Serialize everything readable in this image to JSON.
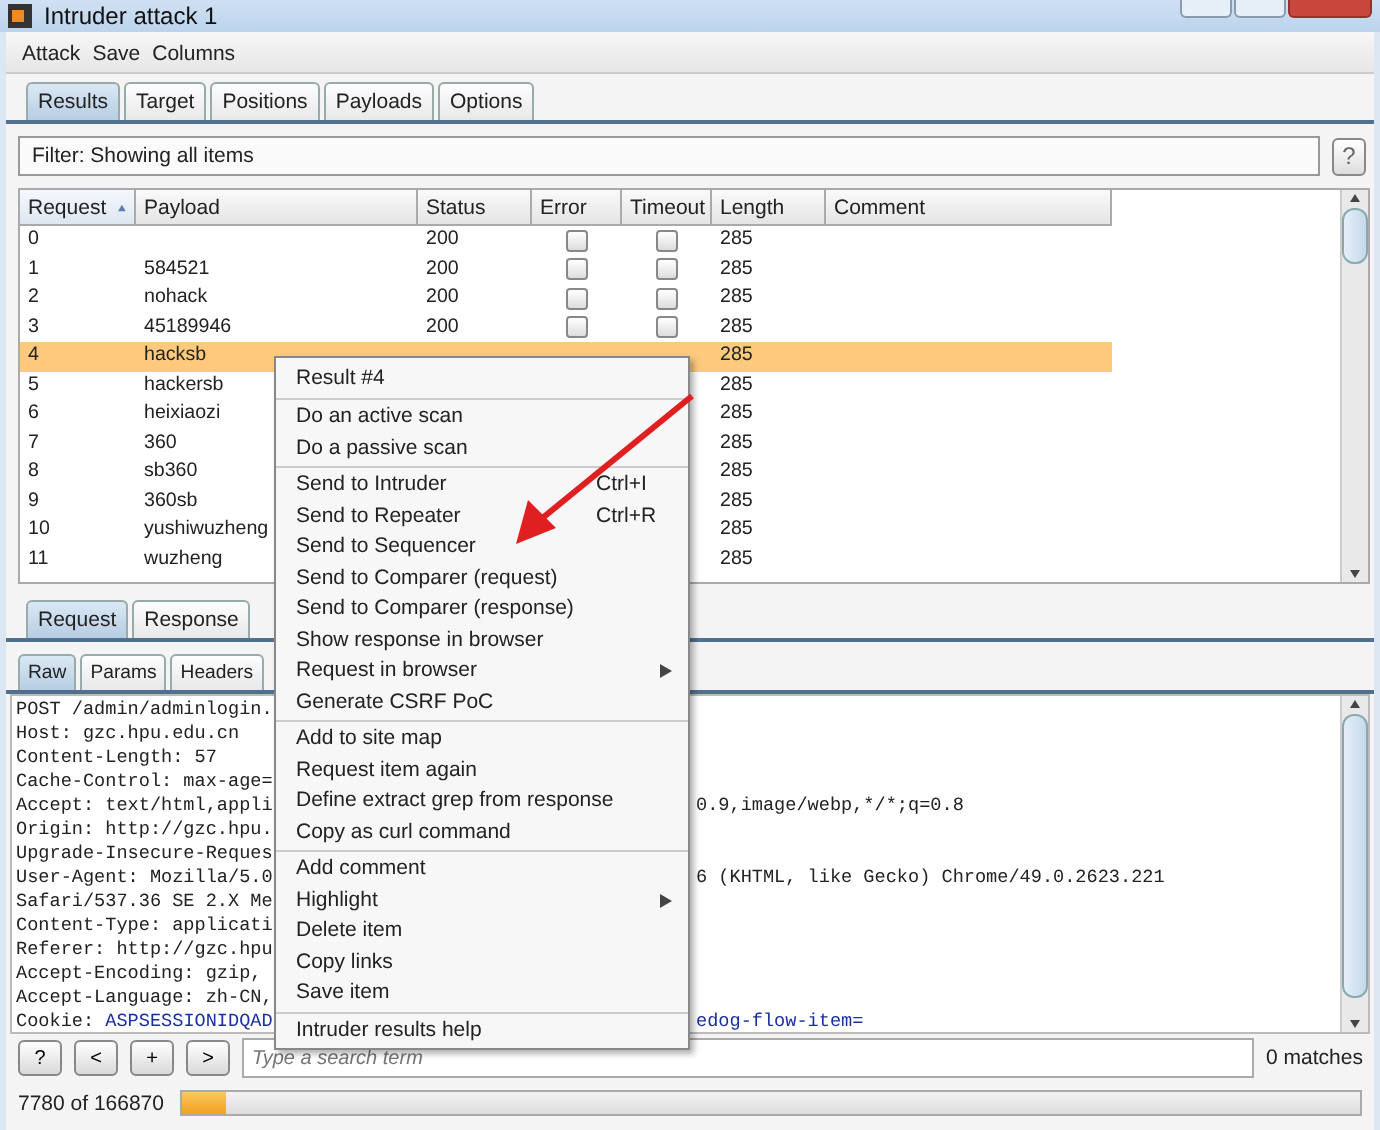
{
  "window": {
    "title": "Intruder attack 1"
  },
  "menu_bar": [
    "Attack",
    "Save",
    "Columns"
  ],
  "tabs": [
    {
      "label": "Results",
      "selected": true
    },
    {
      "label": "Target",
      "selected": false
    },
    {
      "label": "Positions",
      "selected": false
    },
    {
      "label": "Payloads",
      "selected": false
    },
    {
      "label": "Options",
      "selected": false
    }
  ],
  "filter": {
    "text": "Filter: Showing all items",
    "help": "?"
  },
  "table": {
    "columns": [
      {
        "label": "Request",
        "sorted": true
      },
      {
        "label": "Payload",
        "sorted": false
      },
      {
        "label": "Status",
        "sorted": false
      },
      {
        "label": "Error",
        "sorted": false
      },
      {
        "label": "Timeout",
        "sorted": false
      },
      {
        "label": "Length",
        "sorted": false
      },
      {
        "label": "Comment",
        "sorted": false
      }
    ],
    "rows": [
      {
        "request": "0",
        "status": "200",
        "error": false,
        "timeout": false,
        "length": "285",
        "selected": false
      },
      {
        "request": "1",
        "payload": "584521",
        "status": "200",
        "error": false,
        "timeout": false,
        "length": "285",
        "selected": false
      },
      {
        "request": "2",
        "payload": "nohack",
        "status": "200",
        "error": false,
        "timeout": false,
        "length": "285",
        "selected": false
      },
      {
        "request": "3",
        "payload": "45189946",
        "status": "200",
        "error": false,
        "timeout": false,
        "length": "285",
        "selected": false
      },
      {
        "request": "4",
        "payload": "hacksb",
        "length": "285",
        "selected": true
      },
      {
        "request": "5",
        "payload": "hackersb",
        "length": "285",
        "selected": false
      },
      {
        "request": "6",
        "payload": "heixiaozi",
        "length": "285",
        "selected": false
      },
      {
        "request": "7",
        "payload": "360",
        "length": "285",
        "selected": false
      },
      {
        "request": "8",
        "payload": "sb360",
        "length": "285",
        "selected": false
      },
      {
        "request": "9",
        "payload": "360sb",
        "length": "285",
        "selected": false
      },
      {
        "request": "10",
        "payload": "yushiwuzheng",
        "length": "285",
        "selected": false
      },
      {
        "request": "11",
        "payload": "wuzheng",
        "length": "285",
        "selected": false
      }
    ]
  },
  "message_tabs": [
    {
      "label": "Request",
      "selected": true
    },
    {
      "label": "Response",
      "selected": false
    }
  ],
  "view_tabs": [
    {
      "label": "Raw",
      "selected": true
    },
    {
      "label": "Params",
      "selected": false
    },
    {
      "label": "Headers",
      "selected": false
    }
  ],
  "raw_lines": [
    {
      "left": [
        {
          "text": "POST /admin/adminlogin.",
          "kind": "plain"
        }
      ]
    },
    {
      "left": [
        {
          "text": "Host: gzc.hpu.edu.cn",
          "kind": "plain"
        }
      ]
    },
    {
      "left": [
        {
          "text": "Content-Length: 57",
          "kind": "plain"
        }
      ]
    },
    {
      "left": [
        {
          "text": "Cache-Control: max-age=",
          "kind": "plain"
        }
      ]
    },
    {
      "left": [
        {
          "text": "Accept: text/html,appli",
          "kind": "plain"
        }
      ],
      "right": [
        {
          "text": "0.9,image/webp,*/*;q=0.8",
          "kind": "plain"
        }
      ]
    },
    {
      "left": [
        {
          "text": "Origin: http://gzc.hpu.",
          "kind": "plain"
        }
      ]
    },
    {
      "left": [
        {
          "text": "Upgrade-Insecure-Reques",
          "kind": "plain"
        }
      ]
    },
    {
      "left": [
        {
          "text": "User-Agent: Mozilla/5.0",
          "kind": "plain"
        }
      ],
      "right": [
        {
          "text": "6 (KHTML, like Gecko) Chrome/49.0.2623.221",
          "kind": "plain"
        }
      ]
    },
    {
      "left": [
        {
          "text": "Safari/537.36 SE 2.X Me",
          "kind": "plain"
        }
      ]
    },
    {
      "left": [
        {
          "text": "Content-Type: applicati",
          "kind": "plain"
        }
      ]
    },
    {
      "left": [
        {
          "text": "Referer: http://gzc.hpu",
          "kind": "plain"
        }
      ]
    },
    {
      "left": [
        {
          "text": "Accept-Encoding: gzip,",
          "kind": "plain"
        }
      ]
    },
    {
      "left": [
        {
          "text": "Accept-Language: zh-CN,",
          "kind": "plain"
        }
      ]
    },
    {
      "left": [
        {
          "text": "Cookie: ",
          "kind": "plain"
        },
        {
          "text": "ASPSESSIONIDQAD",
          "kind": "value"
        }
      ],
      "right": [
        {
          "text": "edog-flow-item=",
          "kind": "value"
        }
      ]
    }
  ],
  "search_bar": {
    "buttons": [
      "?",
      "<",
      "+",
      ">"
    ],
    "placeholder": "Type a search term",
    "matches": "0 matches"
  },
  "status": {
    "text": "7780 of 166870",
    "level": 0.03
  },
  "context_menu": {
    "title": "Result #4",
    "groups": [
      [
        {
          "label": "Do an active scan",
          "submenu": false
        },
        {
          "label": "Do a passive scan",
          "submenu": false
        }
      ],
      [
        {
          "label": "Send to Intruder",
          "shortcut": "Ctrl+I",
          "submenu": false
        },
        {
          "label": "Send to Repeater",
          "shortcut": "Ctrl+R",
          "submenu": false
        },
        {
          "label": "Send to Sequencer",
          "submenu": false
        },
        {
          "label": "Send to Comparer (request)",
          "submenu": false
        },
        {
          "label": "Send to Comparer (response)",
          "submenu": false
        },
        {
          "label": "Show response in browser",
          "submenu": false
        },
        {
          "label": "Request in browser",
          "submenu": true
        },
        {
          "label": "Generate CSRF PoC",
          "submenu": false
        }
      ],
      [
        {
          "label": "Add to site map",
          "submenu": false
        },
        {
          "label": "Request item again",
          "submenu": false
        },
        {
          "label": "Define extract grep from response",
          "submenu": false
        },
        {
          "label": "Copy as curl command",
          "submenu": false
        }
      ],
      [
        {
          "label": "Add comment",
          "submenu": false
        },
        {
          "label": "Highlight",
          "submenu": true
        },
        {
          "label": "Delete item",
          "submenu": false
        },
        {
          "label": "Copy links",
          "submenu": false
        },
        {
          "label": "Save item",
          "submenu": false
        }
      ],
      [
        {
          "label": "Intruder results help",
          "submenu": false
        }
      ]
    ]
  }
}
